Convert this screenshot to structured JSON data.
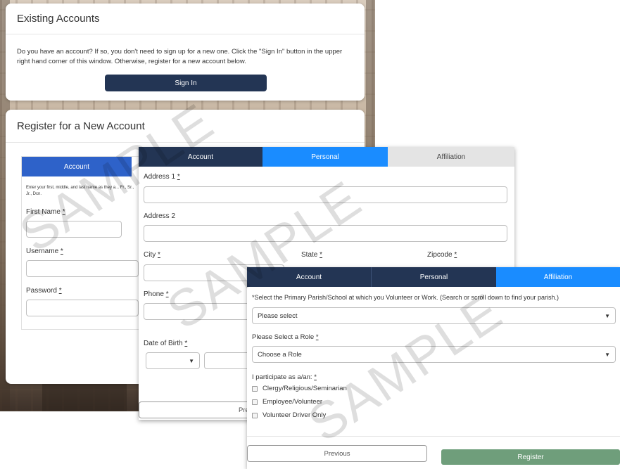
{
  "existing": {
    "title": "Existing Accounts",
    "text": "Do you have an account? If so, you don't need to sign up for a new one. Click the \"Sign In\" button in the upper right hand corner of this window. Otherwise, register for a new account below.",
    "sign_in_label": "Sign In"
  },
  "register": {
    "title": "Register for a New Account",
    "tab_account": "Account",
    "hint": "Enter your first, middle, and last name as they a... Fr., Sr., Jr., Dcn.",
    "first_name_label": "First Name",
    "username_label": "Username",
    "password_label": "Password",
    "req": "*"
  },
  "personal": {
    "tabs": [
      "Account",
      "Personal",
      "Affiliation"
    ],
    "address1_label": "Address 1",
    "address2_label": "Address 2",
    "city_label": "City",
    "state_label": "State",
    "zipcode_label": "Zipcode",
    "phone_label": "Phone",
    "dob_label": "Date of Birth",
    "prev_label": "Previous",
    "req": "*"
  },
  "affiliation": {
    "tabs": [
      "Account",
      "Personal",
      "Affiliation"
    ],
    "parish_prompt": "*Select the Primary Parish/School at which you Volunteer or Work. (Search or scroll down to find your parish.)",
    "parish_value": "Please select",
    "role_label": "Please Select a Role",
    "role_value": "Choose a Role",
    "participate_label": "I participate as a/an:",
    "options": [
      "Clergy/Religious/Seminarian",
      "Employee/Volunteer",
      "Volunteer Driver Only"
    ],
    "prev_label": "Previous",
    "register_label": "Register",
    "req": "*"
  },
  "watermark": "SAMPLE",
  "colors": {
    "navy": "#233554",
    "blue": "#1a8cff",
    "green": "#6f9e7b",
    "gray_tab": "#e4e4e4"
  }
}
